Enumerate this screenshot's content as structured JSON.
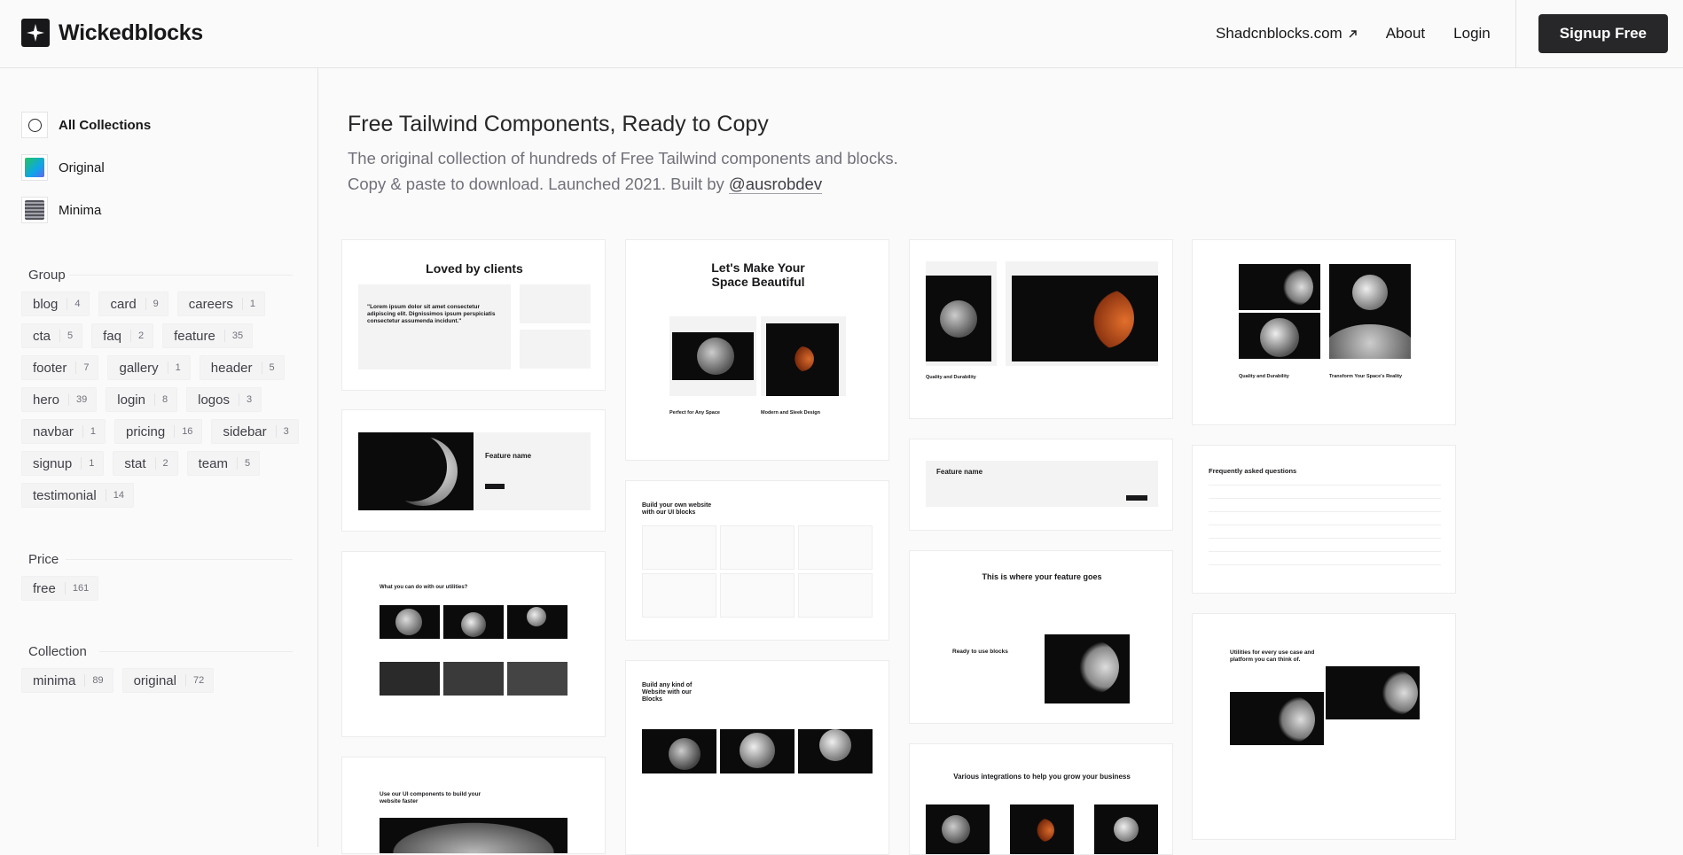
{
  "header": {
    "logo_text": "Wickedblocks",
    "links": [
      {
        "label": "Shadcnblocks.com",
        "external": true
      },
      {
        "label": "About"
      },
      {
        "label": "Login"
      }
    ],
    "signup_label": "Signup Free"
  },
  "sidebar": {
    "collections": [
      {
        "label": "All Collections",
        "icon": "circle-icon"
      },
      {
        "label": "Original",
        "icon": "gradient-swatch-icon"
      },
      {
        "label": "Minima",
        "icon": "grid-swatch-icon"
      }
    ],
    "group_title": "Group",
    "groups": [
      {
        "name": "blog",
        "count": "4"
      },
      {
        "name": "card",
        "count": "9"
      },
      {
        "name": "careers",
        "count": "1"
      },
      {
        "name": "cta",
        "count": "5"
      },
      {
        "name": "faq",
        "count": "2"
      },
      {
        "name": "feature",
        "count": "35"
      },
      {
        "name": "footer",
        "count": "7"
      },
      {
        "name": "gallery",
        "count": "1"
      },
      {
        "name": "header",
        "count": "5"
      },
      {
        "name": "hero",
        "count": "39"
      },
      {
        "name": "login",
        "count": "8"
      },
      {
        "name": "logos",
        "count": "3"
      },
      {
        "name": "navbar",
        "count": "1"
      },
      {
        "name": "pricing",
        "count": "16"
      },
      {
        "name": "sidebar",
        "count": "3"
      },
      {
        "name": "signup",
        "count": "1"
      },
      {
        "name": "stat",
        "count": "2"
      },
      {
        "name": "team",
        "count": "5"
      },
      {
        "name": "testimonial",
        "count": "14"
      }
    ],
    "price_title": "Price",
    "prices": [
      {
        "name": "free",
        "count": "161"
      }
    ],
    "collection_title": "Collection",
    "collection_tags": [
      {
        "name": "minima",
        "count": "89"
      },
      {
        "name": "original",
        "count": "72"
      }
    ]
  },
  "main": {
    "title": "Free Tailwind Components, Ready to Copy",
    "subtitle_line1": "The original collection of hundreds of Free Tailwind components and blocks.",
    "subtitle_line2_prefix": "Copy & paste to download. Launched 2021. Built by ",
    "subtitle_handle": "@ausrobdev"
  },
  "previews": {
    "loved_title": "Loved by clients",
    "loved_quote": "\"Lorem ipsum dolor sit amet consectetur adipiscing elit. Dignissimos ipsum perspiciatis consectetur assumenda incidunt.\"",
    "space_title_1": "Let's Make Your",
    "space_title_2": "Space Beautiful",
    "space_col1": "Perfect for Any Space",
    "space_col2": "Modern and Sleek Design",
    "quality_label": "Quality and Durability",
    "transform_label": "Transform Your Space's Reality",
    "feature_name": "Feature name",
    "build_title_1": "Build your own website",
    "build_title_2": "with our UI blocks",
    "faq_title": "Frequently asked questions",
    "utilities_title": "What you can do with our utilities?",
    "feature_goes": "This is where your feature goes",
    "ready_label": "Ready to use blocks",
    "any_kind_1": "Build any kind of",
    "any_kind_2": "Website with our",
    "any_kind_3": "Blocks",
    "every_use_1": "Utilities for every use case and",
    "every_use_2": "platform you can think of.",
    "ui_components_1": "Use our UI components to build your",
    "ui_components_2": "website faster",
    "integrations_title": "Various integrations to help you grow your business"
  }
}
